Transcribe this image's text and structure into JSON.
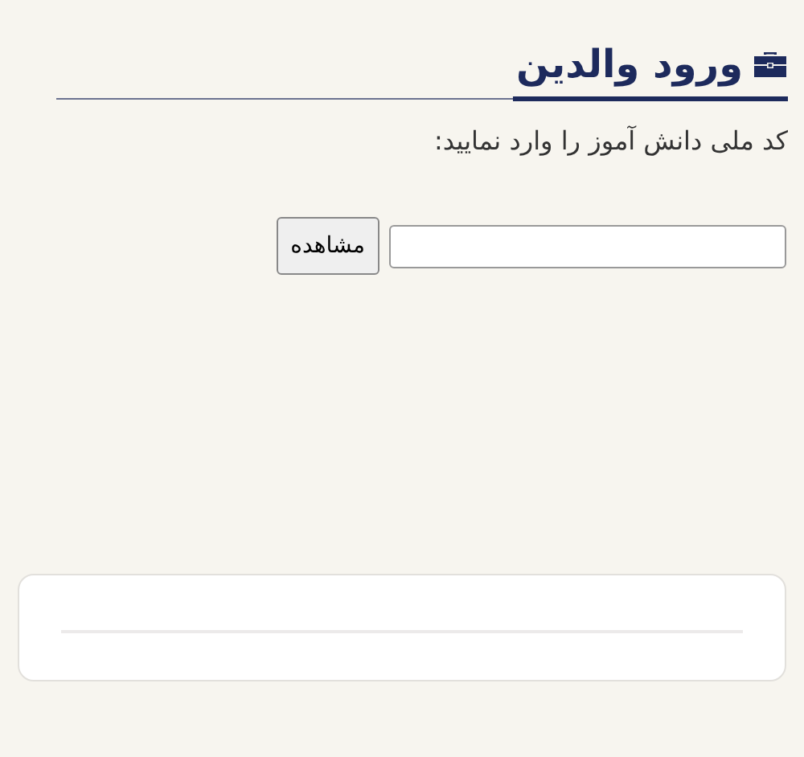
{
  "header": {
    "title": "ورود والدین"
  },
  "form": {
    "label": "کد ملی دانش آموز را وارد نمایید:",
    "button": "مشاهده"
  }
}
